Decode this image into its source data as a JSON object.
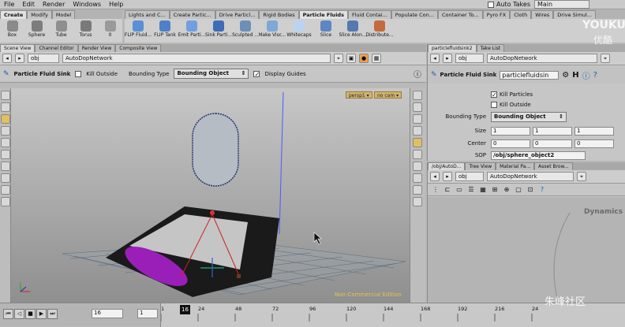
{
  "menu": [
    "File",
    "Edit",
    "Render",
    "Windows",
    "Help"
  ],
  "top_right": {
    "auto_takes": "Auto Takes",
    "desktop": "Main"
  },
  "shelf_tabs_left": [
    {
      "label": "Create",
      "active": true
    },
    {
      "label": "Modify",
      "active": false
    },
    {
      "label": "Model",
      "active": false
    }
  ],
  "shelf_tabs_right": [
    {
      "label": "Lights and C...",
      "active": false
    },
    {
      "label": "Create Partic...",
      "active": false
    },
    {
      "label": "Drive Particl...",
      "active": false
    },
    {
      "label": "Rigid Bodies",
      "active": false
    },
    {
      "label": "Particle Fluids",
      "active": true
    },
    {
      "label": "Fluid Contai...",
      "active": false
    },
    {
      "label": "Populate Con...",
      "active": false
    },
    {
      "label": "Container To...",
      "active": false
    },
    {
      "label": "Pyro FX",
      "active": false
    },
    {
      "label": "Cloth",
      "active": false
    },
    {
      "label": "Wires",
      "active": false
    },
    {
      "label": "Drive Simul...",
      "active": false
    }
  ],
  "tools_left": [
    {
      "label": "Box",
      "icon": "box-icon",
      "color": "#8a8a8a"
    },
    {
      "label": "Sphere",
      "icon": "sphere-icon",
      "color": "#7d7d7d"
    },
    {
      "label": "Tube",
      "icon": "tube-icon",
      "color": "#8f8f8f"
    },
    {
      "label": "Torus",
      "icon": "torus-icon",
      "color": "#7a7a7a"
    },
    {
      "label": "0",
      "icon": "grid-icon",
      "color": "#9a9a9a"
    }
  ],
  "tools_right": [
    {
      "label": "FLIP Fluid...",
      "icon": "flip-fluid-icon",
      "color": "#5b8fd6"
    },
    {
      "label": "FLIP Tank",
      "icon": "flip-tank-icon",
      "color": "#4f7fc9"
    },
    {
      "label": "Emit Parti...",
      "icon": "emit-particles-icon",
      "color": "#6f9fe0"
    },
    {
      "label": "Sink Parti...",
      "icon": "sink-particles-icon",
      "color": "#3e6db5"
    },
    {
      "label": "Sculpted ...",
      "icon": "sculpted-icon",
      "color": "#6b8fb8"
    },
    {
      "label": "Make Visc...",
      "icon": "make-viscous-icon",
      "color": "#7fa7d8"
    },
    {
      "label": "Whitecaps",
      "icon": "whitecaps-icon",
      "color": "#b8d4f0"
    },
    {
      "label": "Slice",
      "icon": "slice-icon",
      "color": "#5d86c2"
    },
    {
      "label": "Slice Alon...",
      "icon": "slice-along-icon",
      "color": "#5578b0"
    },
    {
      "label": "Distribute...",
      "icon": "distribute-icon",
      "color": "#c46a3d"
    }
  ],
  "left_pane": {
    "tabs": [
      {
        "label": "Scene View",
        "active": true
      },
      {
        "label": "Channel Editor",
        "active": false
      },
      {
        "label": "Render View",
        "active": false
      },
      {
        "label": "Composite View",
        "active": false
      }
    ],
    "path_root": "obj",
    "path_node": "AutoDopNetwork",
    "tool_name": "Particle Fluid Sink",
    "kill_outside": "Kill Outside",
    "bounding_type_label": "Bounding Type",
    "bounding_type_value": "Bounding Object",
    "display_guides": "Display Guides",
    "cam_tags": [
      "persp1 ▾",
      "no cam ▾"
    ],
    "watermark": "Non-Commercial Edition"
  },
  "parm_pane": {
    "tabs": [
      {
        "label": "particlefluidsink2",
        "active": true
      },
      {
        "label": "Take List",
        "active": false
      }
    ],
    "path_root": "obj",
    "path_node": "AutoDopNetwork",
    "node_type": "Particle Fluid Sink",
    "node_name": "particlefluidsin",
    "kill_particles": "Kill Particles",
    "kill_outside": "Kill Outside",
    "bounding_type_label": "Bounding Type",
    "bounding_type_value": "Bounding Object",
    "size_label": "Size",
    "size": [
      "1",
      "1",
      "1"
    ],
    "center_label": "Center",
    "center": [
      "0",
      "0",
      "0"
    ],
    "sop_label": "SOP",
    "sop_value": "/obj/sphere_object2"
  },
  "net_pane": {
    "tabs": [
      {
        "label": "/obj/AutoD...",
        "active": true
      },
      {
        "label": "Tree View",
        "active": false
      },
      {
        "label": "Material Pa...",
        "active": false
      },
      {
        "label": "Asset Brow...",
        "active": false
      }
    ],
    "path_root": "obj",
    "path_node": "AutoDopNetwork",
    "context_label": "Dynamics"
  },
  "timeline": {
    "current_frame": "16",
    "start_frame": "1",
    "ticks": [
      "1",
      "24",
      "48",
      "72",
      "96",
      "120",
      "144",
      "168",
      "192",
      "216",
      "24"
    ],
    "playhead_label": "16"
  },
  "overlay": {
    "youku": "YOUKU",
    "youku_cn": "优酷",
    "site": "朱峰社区"
  }
}
